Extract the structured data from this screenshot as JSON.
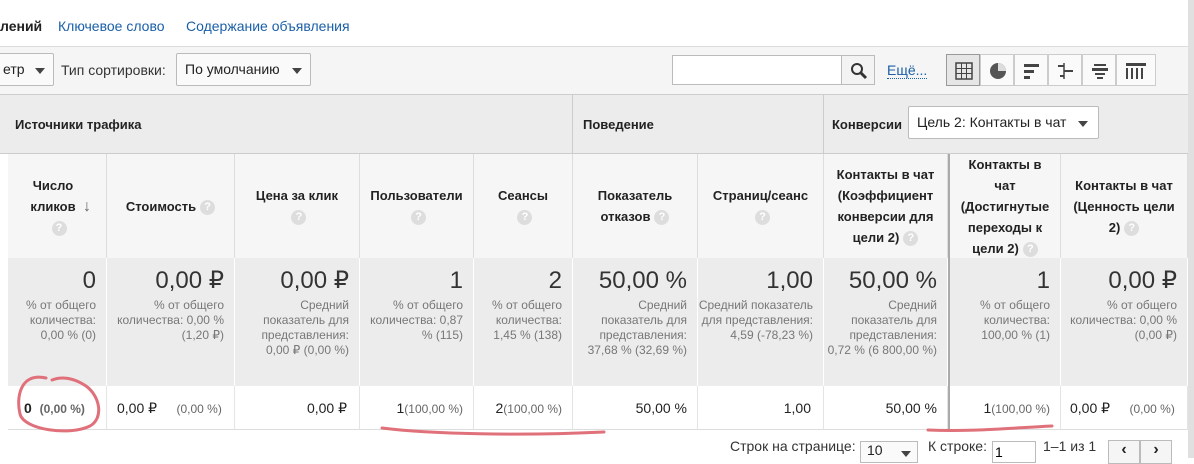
{
  "tabs": [
    {
      "label": "лений",
      "active": true
    },
    {
      "label": "Ключевое слово",
      "active": false
    },
    {
      "label": "Содержание объявления",
      "active": false
    }
  ],
  "toolbar": {
    "filter_select": "етр",
    "sort_label": "Тип сортировки:",
    "sort_select": "По умолчанию",
    "search_placeholder": "",
    "more_link": "Ещё..."
  },
  "groups": {
    "traffic": "Источники трафика",
    "behavior": "Поведение",
    "conversions": "Конверсии",
    "goal_select": "Цель 2: Контакты в чат"
  },
  "columns": [
    {
      "label": "Число кликов",
      "help": "?",
      "sorted": true,
      "total_value": "0",
      "total_sub": "% от общего количества: 0,00 % (0)",
      "row_value": "0",
      "row_pct": "(0,00 %)"
    },
    {
      "label": "Стоимость",
      "help": "?",
      "total_value": "0,00 ₽",
      "total_sub": "% от общего количества: 0,00 % (1,20 ₽)",
      "row_value": "0,00 ₽",
      "row_pct": "(0,00 %)"
    },
    {
      "label": "Цена за клик",
      "help": "?",
      "total_value": "0,00 ₽",
      "total_sub": "Средний показатель для представления: 0,00 ₽ (0,00 %)",
      "row_value": "0,00 ₽",
      "row_pct": ""
    },
    {
      "label": "Пользователи",
      "help": "?",
      "total_value": "1",
      "total_sub": "% от общего количества: 0,87 % (115)",
      "row_value": "1",
      "row_pct": "(100,00 %)"
    },
    {
      "label": "Сеансы",
      "help": "?",
      "total_value": "2",
      "total_sub": "% от общего количества: 1,45 % (138)",
      "row_value": "2",
      "row_pct": "(100,00 %)"
    },
    {
      "label": "Показатель отказов",
      "help": "?",
      "total_value": "50,00 %",
      "total_sub": "Средний показатель для представления: 37,68 % (32,69 %)",
      "row_value": "50,00 %",
      "row_pct": ""
    },
    {
      "label": "Страниц/сеанс",
      "help": "?",
      "total_value": "1,00",
      "total_sub": "Средний показатель для представления: 4,59 (-78,23 %)",
      "row_value": "1,00",
      "row_pct": ""
    },
    {
      "label": "Контакты в чат (Коэффициент конверсии для цели 2)",
      "help": "?",
      "total_value": "50,00 %",
      "total_sub": "Средний показатель для представления: 0,72 % (6 800,00 %)",
      "row_value": "50,00 %",
      "row_pct": ""
    },
    {
      "label": "Контакты в чат (Достигнутые переходы к цели 2)",
      "help": "?",
      "total_value": "1",
      "total_sub": "% от общего количества: 100,00 % (1)",
      "row_value": "1",
      "row_pct": "(100,00 %)"
    },
    {
      "label": "Контакты в чат (Ценность цели 2)",
      "help": "?",
      "total_value": "0,00 ₽",
      "total_sub": "% от общего количества: 0,00 % (0,00 ₽)",
      "row_value": "0,00 ₽",
      "row_pct": "(0,00 %)"
    }
  ],
  "pager": {
    "rows_label": "Строк на странице:",
    "rows_value": "10",
    "goto_label": "К строке:",
    "goto_value": "1",
    "range": "1–1 из 1"
  },
  "colors": {
    "link": "#1a5fa8",
    "annotation": "#e0707a",
    "header_bg": "#ececec"
  }
}
